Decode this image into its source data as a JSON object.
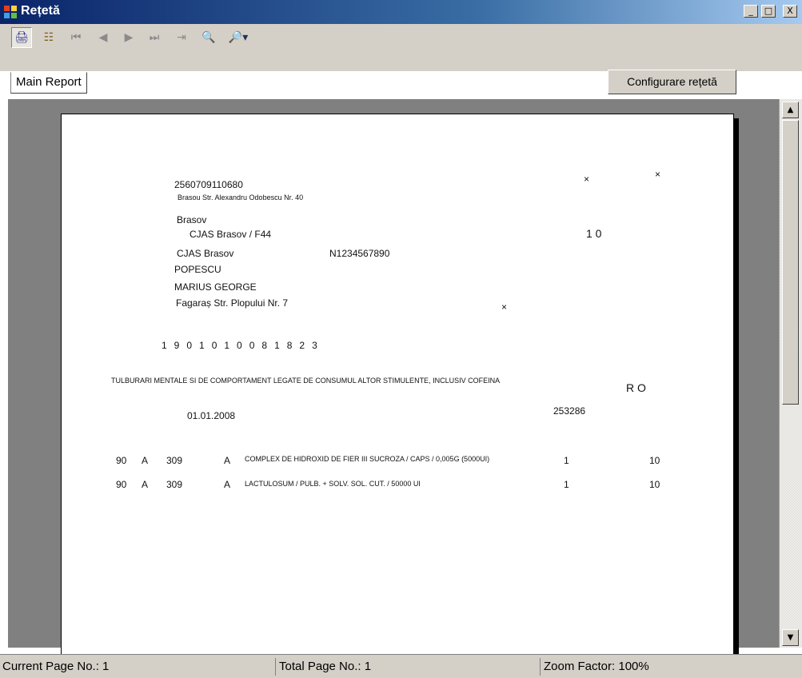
{
  "window": {
    "title": "Rețetă",
    "icon": "app-grid-icon",
    "controls": {
      "minimize": "_",
      "maximize": "□",
      "close": "X"
    }
  },
  "toolbar": {
    "buttons": [
      {
        "icon": "print-icon",
        "glyph": "🖨"
      },
      {
        "icon": "tree-view-icon",
        "glyph": "☷"
      },
      {
        "icon": "first-page-icon",
        "glyph": "⏮"
      },
      {
        "icon": "previous-page-icon",
        "glyph": "◀"
      },
      {
        "icon": "next-page-icon",
        "glyph": "▶"
      },
      {
        "icon": "last-page-icon",
        "glyph": "⏭"
      },
      {
        "icon": "export-icon",
        "glyph": "⇥"
      },
      {
        "icon": "search-icon",
        "glyph": "🔍"
      },
      {
        "icon": "zoom-icon",
        "glyph": "🔎▾"
      }
    ],
    "tab_label": "Main Report",
    "config_button": "Configurare rețetă"
  },
  "report": {
    "cnp": "2560709110680",
    "address1": "Brasou Str. Alexandru Odobescu Nr. 40",
    "city": "Brasov",
    "cjas": "CJAS Brasov / F44",
    "cjas2": "CJAS Brasov",
    "code": "N1234567890",
    "lastname": "POPESCU",
    "firstname": "MARIUS GEORGE",
    "address2": "Fagaraș Str. Plopului Nr. 7",
    "id_number": "1901010081823",
    "mark_x": "×",
    "days": "1 0",
    "diagnosis": "TULBURARI MENTALE SI DE COMPORTAMENT LEGATE DE CONSUMUL ALTOR STIMULENTE, INCLUSIV COFEINA",
    "country": "R O",
    "date": "01.01.2008",
    "number": "253286",
    "items": [
      {
        "col1": "90",
        "col2": "A",
        "col3": "309",
        "col4": "A",
        "drug": "COMPLEX DE HIDROXID DE FIER III SUCROZA / CAPS / 0,005G (5000UI)",
        "qty": "1",
        "days": "10"
      },
      {
        "col1": "90",
        "col2": "A",
        "col3": "309",
        "col4": "A",
        "drug": "LACTULOSUM / PULB. + SOLV. SOL. CUT. / 50000 UI",
        "qty": "1",
        "days": "10"
      }
    ]
  },
  "status": {
    "current_page": "Current Page No.: 1",
    "total_page": "Total Page No.: 1",
    "zoom": "Zoom Factor: 100%"
  },
  "colors": {
    "titlebar_start": "#0a246a",
    "face": "#d4d0c8",
    "viewer": "#808080"
  }
}
